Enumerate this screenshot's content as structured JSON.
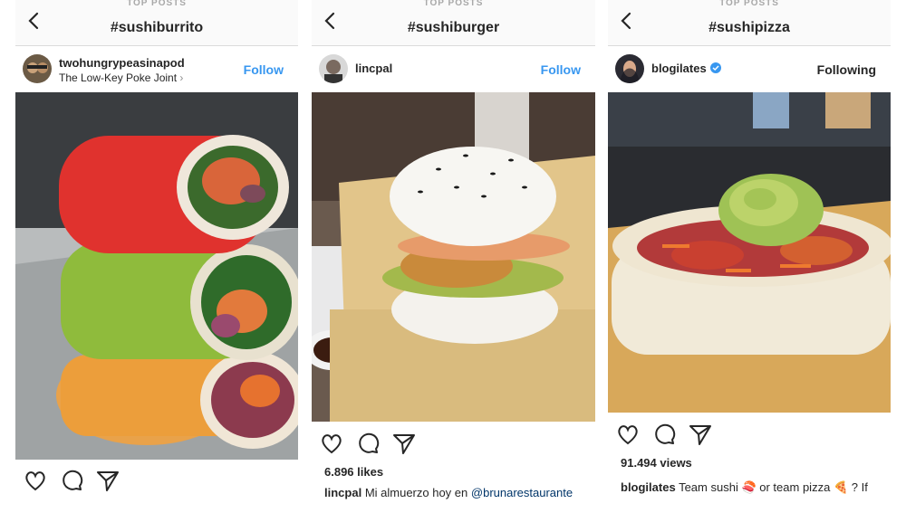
{
  "panels": [
    {
      "top_label": "TOP POSTS",
      "hashtag": "#sushiburrito",
      "username": "twohungrypeasinapod",
      "location": "The Low-Key Poke Joint",
      "follow_label": "Follow",
      "icons": [
        "back-chevron-icon",
        "heart-icon",
        "comment-icon",
        "share-icon",
        "chevron-right-icon"
      ]
    },
    {
      "top_label": "TOP POSTS",
      "hashtag": "#sushiburger",
      "username": "lincpal",
      "follow_label": "Follow",
      "likes": "6.896 likes",
      "caption_user": "lincpal",
      "caption_text": "Mi almuerzo hoy en",
      "caption_mention": "@brunarestaurante"
    },
    {
      "top_label": "TOP POSTS",
      "hashtag": "#sushipizza",
      "username": "blogilates",
      "follow_label": "Following",
      "views": "91.494 views",
      "caption_user": "blogilates",
      "caption_text_1": "Team sushi",
      "caption_emoji_1": "🍣",
      "caption_text_2": "or team pizza",
      "caption_emoji_2": "🍕",
      "caption_text_3": "? If",
      "icons": [
        "verified-badge-icon"
      ]
    }
  ],
  "colors": {
    "link_blue": "#3897f0",
    "mention_blue": "#003569",
    "divider": "#dbdbdb",
    "verified": "#3897f0"
  }
}
